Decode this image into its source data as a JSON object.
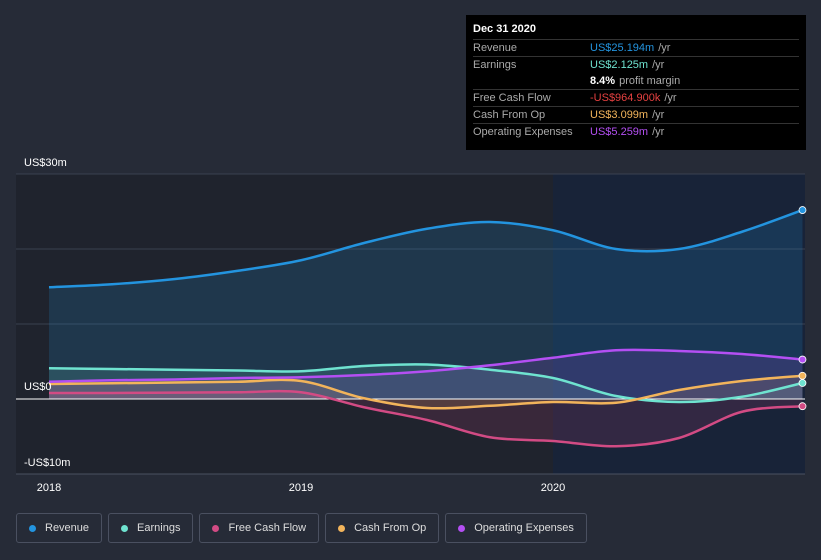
{
  "tooltip": {
    "date": "Dec 31 2020",
    "rows": [
      {
        "label": "Revenue",
        "value": "US$25.194m",
        "unit": "/yr",
        "color": "#2394df"
      },
      {
        "label": "Earnings",
        "value": "US$2.125m",
        "unit": "/yr",
        "color": "#6fe3d0"
      },
      {
        "label": "",
        "value": "8.4%",
        "unit": "profit margin",
        "color": "#ffffff"
      },
      {
        "label": "Free Cash Flow",
        "value": "-US$964.900k",
        "unit": "/yr",
        "color": "#e64141"
      },
      {
        "label": "Cash From Op",
        "value": "US$3.099m",
        "unit": "/yr",
        "color": "#f2b45b"
      },
      {
        "label": "Operating Expenses",
        "value": "US$5.259m",
        "unit": "/yr",
        "color": "#b44ff3"
      }
    ]
  },
  "chart_data": {
    "type": "line",
    "y_tick_labels": [
      "US$30m",
      "US$0",
      "-US$10m"
    ],
    "ylim": [
      -10,
      30
    ],
    "x_tick_labels": [
      "2018",
      "2019",
      "2020"
    ],
    "xlim": [
      2017.93,
      2020.99
    ],
    "x": [
      2018.0,
      2018.25,
      2018.5,
      2018.75,
      2019.0,
      2019.25,
      2019.5,
      2019.75,
      2020.0,
      2020.25,
      2020.5,
      2020.75,
      2020.99
    ],
    "highlight_from": 2020.0,
    "grid": true,
    "series": [
      {
        "name": "Revenue",
        "color": "#2394df",
        "values": [
          14.9,
          15.3,
          16.0,
          17.1,
          18.5,
          20.8,
          22.7,
          23.6,
          22.5,
          20.0,
          20.0,
          22.3,
          25.19
        ]
      },
      {
        "name": "Earnings",
        "color": "#6fe3d0",
        "values": [
          4.1,
          4.0,
          3.9,
          3.8,
          3.7,
          4.4,
          4.6,
          3.9,
          2.8,
          0.4,
          -0.4,
          0.3,
          2.13
        ]
      },
      {
        "name": "Free Cash Flow",
        "color": "#d24b84",
        "values": [
          0.8,
          0.8,
          0.85,
          0.9,
          0.9,
          -1.1,
          -2.8,
          -5.1,
          -5.6,
          -6.3,
          -5.2,
          -1.7,
          -0.96
        ]
      },
      {
        "name": "Cash From Op",
        "color": "#f2b45b",
        "values": [
          2.0,
          2.1,
          2.2,
          2.3,
          2.4,
          0.1,
          -1.2,
          -0.9,
          -0.4,
          -0.5,
          1.2,
          2.4,
          3.1
        ]
      },
      {
        "name": "Operating Expenses",
        "color": "#b44ff3",
        "values": [
          2.3,
          2.5,
          2.6,
          2.8,
          2.9,
          3.2,
          3.7,
          4.5,
          5.5,
          6.5,
          6.4,
          6.0,
          5.26
        ]
      }
    ]
  }
}
